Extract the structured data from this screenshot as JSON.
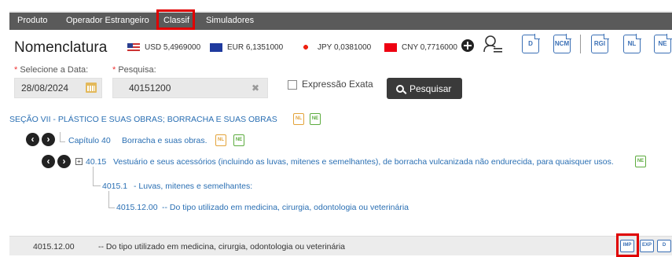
{
  "nav": {
    "items": [
      "Produto",
      "Operador Estrangeiro",
      "Classif",
      "Simuladores"
    ],
    "active": "Classif",
    "bar_color": "#5a5a5a",
    "highlight_color": "#e00000"
  },
  "header": {
    "title": "Nomenclatura",
    "currencies": [
      {
        "label": "USD 5,4969000",
        "flag": "us-flag-icon"
      },
      {
        "label": "EUR 6,1351000",
        "flag": "eu-flag-icon"
      },
      {
        "label": "JPY 0,0381000",
        "flag": "jp-flag-icon"
      },
      {
        "label": "CNY 0,7716000",
        "flag": "cn-flag-icon"
      }
    ],
    "doc_buttons": [
      "D",
      "NCM",
      "RGI",
      "NL",
      "NE"
    ]
  },
  "form": {
    "date_label": "Selecione a Data:",
    "date_value": "28/08/2024",
    "search_label": "Pesquisa:",
    "search_value": "40151200",
    "required_mark": "*",
    "exact_label": "Expressão Exata",
    "search_button": "Pesquisar"
  },
  "tree": {
    "section": "SEÇÃO VII - PLÁSTICO E SUAS OBRAS; BORRACHA E SUAS OBRAS",
    "chapter_code": "Capítulo 40",
    "chapter_desc": "Borracha e suas obras.",
    "heading_code": "40.15",
    "heading_desc": "Vestuário e seus acessórios (incluindo as luvas, mitenes e semelhantes), de borracha vulcanizada não endurecida, para quaisquer usos.",
    "sub_code": "4015.1",
    "sub_desc": "- Luvas, mitenes e semelhantes:",
    "item_code": "4015.12.00",
    "item_desc": "-- Do tipo utilizado em medicina, cirurgia, odontologia ou veterinária",
    "icon_nl": "NL",
    "icon_ne": "NE"
  },
  "result": {
    "code": "4015.12.00",
    "desc": "-- Do tipo utilizado em medicina, cirurgia, odontologia ou veterinária",
    "buttons": [
      "IMP",
      "EXP",
      "D"
    ]
  }
}
